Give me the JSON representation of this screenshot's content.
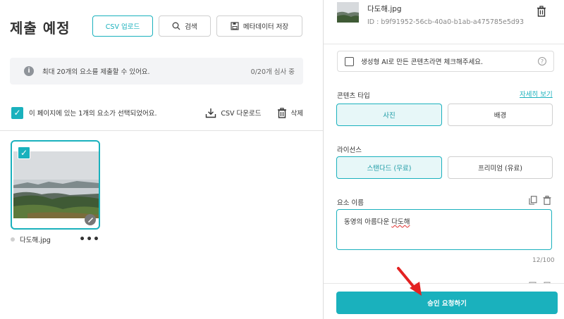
{
  "left": {
    "title": "제출 예정",
    "toolbar": {
      "csv_upload": "CSV 업로드",
      "search": "검색",
      "save_metadata": "메타데이터 저장"
    },
    "info": {
      "message": "최대 20개의 요소를 제출할 수 있어요.",
      "count": "0/20개 심사 중"
    },
    "selection": {
      "text": "이 페이지에 있는 1개의 요소가 선택되었어요.",
      "csv_download": "CSV 다운로드",
      "delete": "삭제"
    },
    "items": [
      {
        "filename": "다도해.jpg",
        "selected": true
      }
    ]
  },
  "right": {
    "file": {
      "name": "다도해.jpg",
      "id": "ID : b9f91952-56cb-40a0-b1ab-a475785e5d93"
    },
    "ai_checkbox_label": "생성형 AI로 만든 콘텐츠라면 체크해주세요.",
    "content_type": {
      "label": "콘텐츠 타입",
      "more_link": "자세히 보기",
      "options": [
        "사진",
        "배경"
      ],
      "selected": "사진"
    },
    "license": {
      "label": "라이선스",
      "options": [
        "스탠다드 (무료)",
        "프리미엄 (유료)"
      ],
      "selected": "스탠다드 (무료)"
    },
    "element_name": {
      "label": "요소 이름",
      "value_prefix": "동영의 아름다운 ",
      "value_misspelled": "다도해",
      "char_count": "12/100"
    },
    "submit_label": "승인 요청하기"
  },
  "colors": {
    "accent": "#1ab1bd",
    "arrow": "#e32222"
  }
}
